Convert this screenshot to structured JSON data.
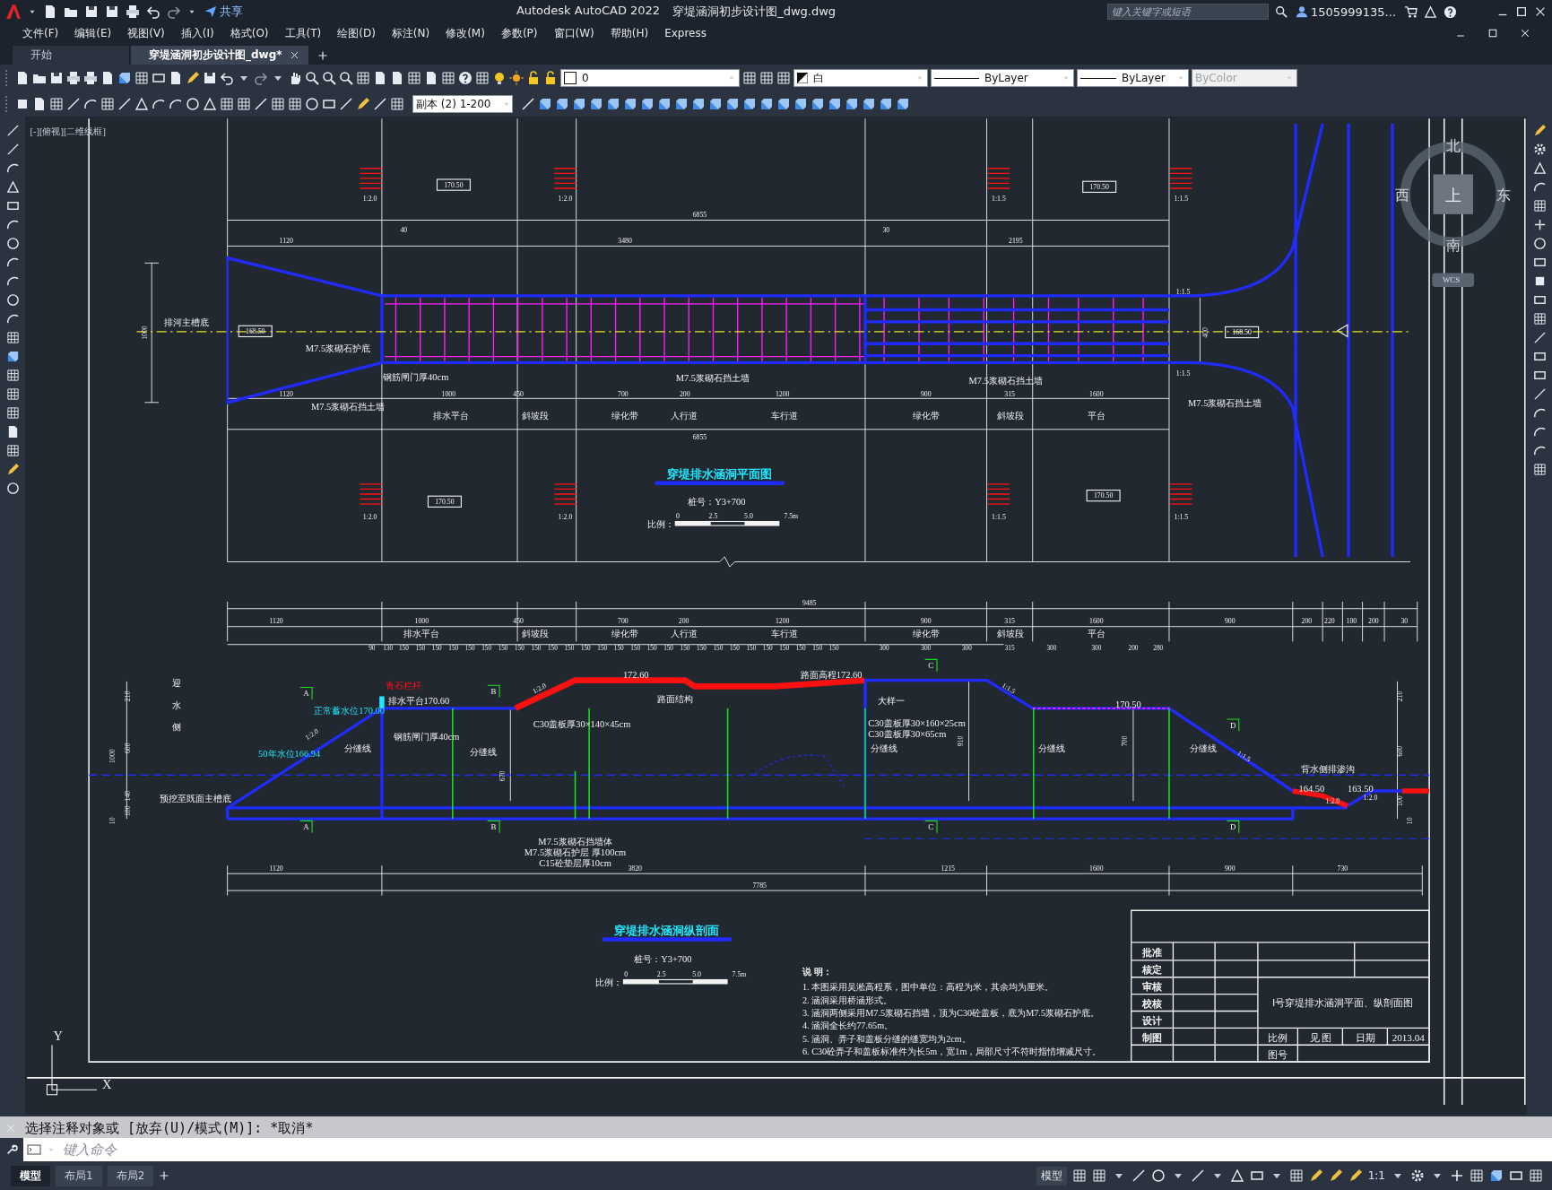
{
  "title_bar": {
    "app": "Autodesk AutoCAD 2022",
    "file": "穿堤涵洞初步设计图_dwg.dwg",
    "share": "共享",
    "search": {
      "placeholder": "键入关键字或短语"
    },
    "user": "1505999135..."
  },
  "menu": [
    "文件(F)",
    "编辑(E)",
    "视图(V)",
    "插入(I)",
    "格式(O)",
    "工具(T)",
    "绘图(D)",
    "标注(N)",
    "修改(M)",
    "参数(P)",
    "窗口(W)",
    "帮助(H)",
    "Express"
  ],
  "doc_tabs": [
    {
      "label": "开始",
      "selected": false
    },
    {
      "label": "穿堤涵洞初步设计图_dwg*",
      "selected": true
    }
  ],
  "toolbar": {
    "layer": "0",
    "color_name": "白",
    "linetype": "ByLayer",
    "lineweight": "ByLayer",
    "plotstyle": {
      "value": "ByColor",
      "disabled": true
    },
    "annotation_scale": "副本 (2) 1-200"
  },
  "viewport_label": "[-][俯视][二维线框]",
  "viewcube": {
    "north": "北",
    "south": "南",
    "east": "东",
    "west": "西",
    "top": "上",
    "wcs": "WCS"
  },
  "ucs": {
    "y": "Y",
    "x": "X"
  },
  "plan": {
    "title": "穿堤排水涵洞平面图",
    "station": "桩号：Y3+700",
    "scale_label": "比例：",
    "scale_ticks": [
      "0",
      "2.5",
      "5.0",
      "7.5m"
    ],
    "slopes": [
      "1:2.0",
      "1:2.0",
      "1:1.5",
      "1:1.5",
      "1:1.5",
      "1:1.5",
      "1:2.0",
      "1:2.0",
      "1:1.5",
      "1:1.5"
    ],
    "elevations": [
      "170.50",
      "170.50",
      "170.50",
      "170.50",
      "168.50",
      "168.50"
    ],
    "dims": [
      "6855",
      "40",
      "30",
      "1120",
      "3480",
      "2195",
      "1000",
      "400",
      "1120",
      "1000",
      "450",
      "700",
      "200",
      "1200",
      "900",
      "315",
      "1600",
      "6855"
    ],
    "zones": [
      "排水平台",
      "斜坡段",
      "绿化带",
      "人行道",
      "车行道",
      "绿化带",
      "斜坡段",
      "平台"
    ],
    "annotations": [
      "排河主槽底",
      "M7.5浆砌石护底",
      "钢筋闸门厚40cm",
      "M7.5浆砌石挡土墙",
      "M7.5浆砌石挡土墙",
      "M7.5浆砌石挡土墙",
      "M7.5浆砌石挡土墙"
    ]
  },
  "section": {
    "title": "穿堤排水涵洞纵剖面",
    "station": "桩号：Y3+700",
    "scale_label": "比例：",
    "scale_ticks": [
      "0",
      "2.5",
      "5.0",
      "7.5m"
    ],
    "side_label": "迎水侧",
    "dims": [
      "9485",
      "1120",
      "1000",
      "450",
      "700",
      "200",
      "1200",
      "900",
      "315",
      "1600",
      "900",
      "200",
      "220",
      "100",
      "200",
      "30"
    ],
    "zones": [
      "排水平台",
      "斜坡段",
      "绿化带",
      "人行道",
      "车行道",
      "绿化带",
      "斜坡段",
      "平台"
    ],
    "subdims": [
      "90",
      "130",
      "150",
      "150",
      "150",
      "150",
      "150",
      "150",
      "150",
      "150",
      "150",
      "150",
      "150",
      "150",
      "150",
      "150",
      "150",
      "150",
      "150",
      "150",
      "150",
      "150",
      "150",
      "150",
      "150",
      "150",
      "150",
      "150",
      "150",
      "300",
      "300",
      "300",
      "315",
      "300",
      "300",
      "200",
      "280"
    ],
    "height_dims": [
      "210",
      "600",
      "1000",
      "140",
      "100",
      "10",
      "210",
      "600",
      "100",
      "10",
      "670",
      "910",
      "700"
    ],
    "slopes": [
      "1:2.0",
      "1:2.0",
      "1:1.5",
      "1:1.5",
      "1:2.0",
      "1:2.0"
    ],
    "markers": [
      "A",
      "A",
      "B",
      "B",
      "C",
      "C",
      "D",
      "D"
    ],
    "annotations": [
      "正常蓄水位170.00",
      "50年水位166.94",
      "预挖至既面主槽底",
      "青石栏杆",
      "排水平台170.60",
      "钢筋闸门厚40cm",
      "分缝线",
      "分缝线",
      "C30盖板厚30×140×45cm",
      "172.60",
      "路面高程172.60",
      "路面结构",
      "大样一",
      "C30盖板厚30×160×25cm",
      "C30盖板厚30×65cm",
      "分缝线",
      "分缝线",
      "分缝线",
      "170.50",
      "背水侧排渗沟",
      "164.50",
      "163.50",
      "M7.5浆砌石挡墙体",
      "M7.5浆砌石护层 厚100cm",
      "C15砼垫层厚10cm"
    ],
    "bottom_dims": [
      "1120",
      "3820",
      "1215",
      "1600",
      "900",
      "730",
      "7785"
    ]
  },
  "notes": {
    "heading": "说 明：",
    "items": [
      "1. 本图采用吴淞高程系，图中单位：高程为米，其余均为厘米。",
      "2. 涵洞采用桥涵形式。",
      "3. 涵洞两侧采用M7.5浆砌石挡墙，顶为C30砼盖板，底为M7.5浆砌石护底。",
      "4. 涵洞全长约77.65m。",
      "5. 涵洞、弄子和盖板分缝的缝宽均为2cm。",
      "6. C30砼弄子和盖板标准件为长5m，宽1m，局部尺寸不符时指情增减尺寸。"
    ]
  },
  "title_block": {
    "roles": [
      "批准",
      "核定",
      "审核",
      "校核",
      "设计",
      "制图"
    ],
    "drawing_title": "Ⅰ号穿堤排水涵洞平面、纵剖面图",
    "scale_label": "比例",
    "scale_value": "见 图",
    "date_label": "日期",
    "date": "2013.04",
    "number_label": "图号"
  },
  "command": {
    "history": "选择注释对象或 [放弃(U)/模式(M)]: *取消*",
    "placeholder": "键入命令"
  },
  "layout_tabs": [
    {
      "label": "模型",
      "selected": true
    },
    {
      "label": "布局1",
      "selected": false
    },
    {
      "label": "布局2",
      "selected": false
    }
  ],
  "status_bar": {
    "model": "模型",
    "scale": "1:1"
  }
}
